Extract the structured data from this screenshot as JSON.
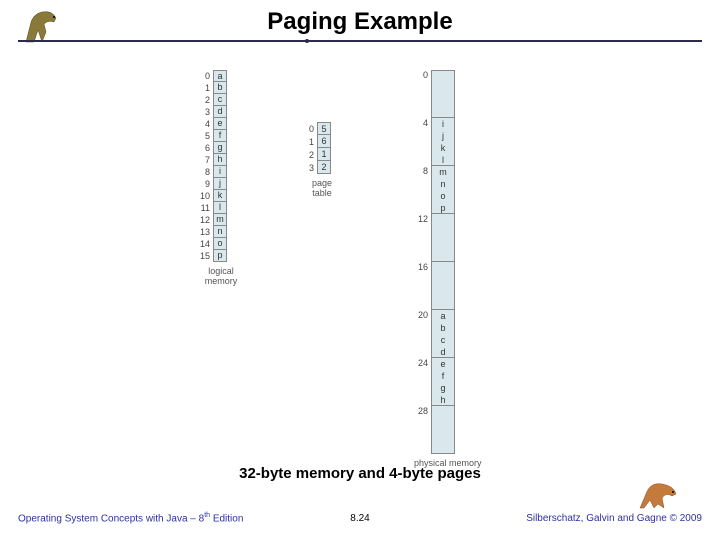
{
  "header": {
    "title": "Paging Example"
  },
  "logical_memory": {
    "label": "logical memory",
    "rows": [
      {
        "idx": "0",
        "val": "a"
      },
      {
        "idx": "1",
        "val": "b"
      },
      {
        "idx": "2",
        "val": "c"
      },
      {
        "idx": "3",
        "val": "d"
      },
      {
        "idx": "4",
        "val": "e"
      },
      {
        "idx": "5",
        "val": "f"
      },
      {
        "idx": "6",
        "val": "g"
      },
      {
        "idx": "7",
        "val": "h"
      },
      {
        "idx": "8",
        "val": "i"
      },
      {
        "idx": "9",
        "val": "j"
      },
      {
        "idx": "10",
        "val": "k"
      },
      {
        "idx": "11",
        "val": "l"
      },
      {
        "idx": "12",
        "val": "m"
      },
      {
        "idx": "13",
        "val": "n"
      },
      {
        "idx": "14",
        "val": "o"
      },
      {
        "idx": "15",
        "val": "p"
      }
    ]
  },
  "page_table": {
    "label": "page table",
    "rows": [
      {
        "idx": "0",
        "val": "5"
      },
      {
        "idx": "1",
        "val": "6"
      },
      {
        "idx": "2",
        "val": "1"
      },
      {
        "idx": "3",
        "val": "2"
      }
    ]
  },
  "physical_memory": {
    "label": "physical memory",
    "frames": [
      {
        "idx": "0",
        "vals": [
          "",
          "",
          "",
          ""
        ]
      },
      {
        "idx": "4",
        "vals": [
          "i",
          "j",
          "k",
          "l"
        ]
      },
      {
        "idx": "8",
        "vals": [
          "m",
          "n",
          "o",
          "p"
        ]
      },
      {
        "idx": "12",
        "vals": [
          "",
          "",
          "",
          ""
        ]
      },
      {
        "idx": "16",
        "vals": [
          "",
          "",
          "",
          ""
        ]
      },
      {
        "idx": "20",
        "vals": [
          "a",
          "b",
          "c",
          "d"
        ]
      },
      {
        "idx": "24",
        "vals": [
          "e",
          "f",
          "g",
          "h"
        ]
      },
      {
        "idx": "28",
        "vals": [
          "",
          "",
          "",
          ""
        ]
      }
    ]
  },
  "caption": "32-byte memory and 4-byte pages",
  "footer": {
    "left_prefix": "Operating System Concepts with Java – 8",
    "left_sup": "th",
    "left_suffix": " Edition",
    "center": "8.24",
    "right": "Silberschatz, Galvin and Gagne © 2009"
  },
  "icons": {
    "dino_left": "dinosaur-icon",
    "dino_right": "dinosaur-icon"
  }
}
